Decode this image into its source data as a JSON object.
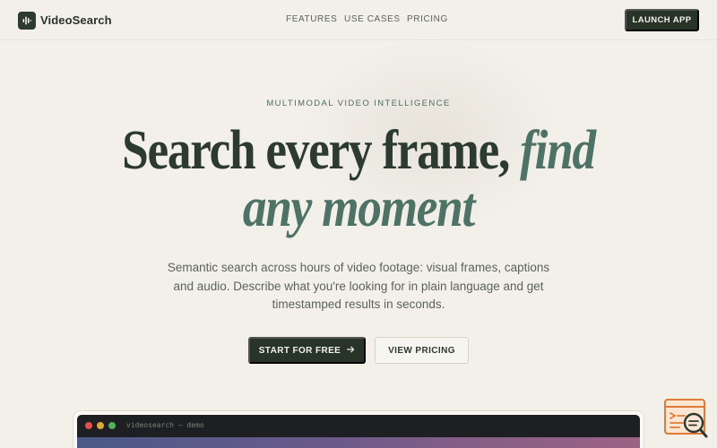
{
  "brand": {
    "name": "VideoSearch",
    "logo_icon": "waveform-icon"
  },
  "nav": {
    "links": [
      "Features",
      "Use cases",
      "Pricing"
    ],
    "launch_label": "LAUNCH APP"
  },
  "hero": {
    "eyebrow": "MULTIMODAL VIDEO INTELLIGENCE",
    "headline_plain": "Search every frame,",
    "headline_em_1": "find",
    "headline_em_2": "any moment",
    "subtext": "Semantic search across hours of video footage: visual frames, captions and audio. Describe what you're looking for in plain language and get timestamped results in seconds.",
    "cta_primary": "START FOR FREE",
    "cta_primary_icon": "arrow-right-icon",
    "cta_secondary": "VIEW PRICING"
  },
  "demo": {
    "window_title": "videosearch — demo"
  },
  "widget": {
    "icon": "search-document-icon"
  },
  "colors": {
    "background": "#f3f0ea",
    "primary_dark": "#293429",
    "accent_green": "#4e7266",
    "widget_orange": "#e07a3a"
  }
}
